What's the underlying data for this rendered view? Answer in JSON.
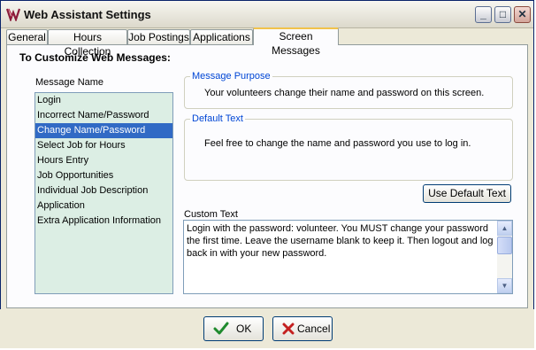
{
  "window": {
    "title": "Web Assistant Settings"
  },
  "tabs": [
    {
      "label": "General"
    },
    {
      "label": "Hours Collection"
    },
    {
      "label": "Job Postings"
    },
    {
      "label": "Applications"
    },
    {
      "label": "Screen Messages"
    }
  ],
  "active_tab": "Screen Messages",
  "main": {
    "heading": "To Customize Web Messages:",
    "list_label": "Message Name",
    "messages": [
      "Login",
      "Incorrect Name/Password",
      "Change Name/Password",
      "Select Job for Hours",
      "Hours Entry",
      "Job Opportunities",
      "Individual Job Description",
      "Application",
      "Extra Application Information"
    ],
    "selected_message": "Change Name/Password",
    "purpose": {
      "legend": "Message Purpose",
      "text": "Your volunteers change their name and password on this screen."
    },
    "default": {
      "legend": "Default Text",
      "text": "Feel free to change the name and password you use to log in."
    },
    "use_default_label": "Use Default Text",
    "custom_label": "Custom Text",
    "custom_text": "Login with the password: volunteer.  You MUST change your password the first time. Leave the username blank to keep it. Then logout and log back in with your new password."
  },
  "footer": {
    "ok_label": "OK",
    "cancel_label": "Cancel"
  },
  "colors": {
    "selection": "#316ac5",
    "list_bg": "#dceee4",
    "legend": "#0046d5",
    "tab_highlight": "#f1c24b"
  }
}
